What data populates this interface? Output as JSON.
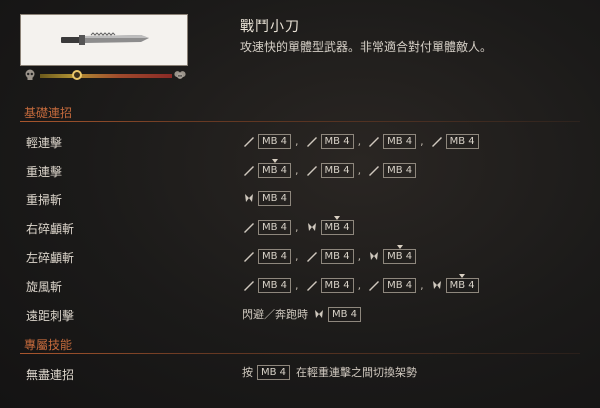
{
  "weapon": {
    "name": "戰鬥小刀",
    "description": "攻速快的單體型武器。非常適合對付單體敵人。",
    "image": "combat-knife",
    "stat_level": 0.28
  },
  "sections": {
    "basic": "基礎連招",
    "special": "專屬技能"
  },
  "mb_label": "MB 4",
  "moves": [
    {
      "name": "輕連擊"
    },
    {
      "name": "重連擊"
    },
    {
      "name": "重掃斬"
    },
    {
      "name": "右碎顱斬"
    },
    {
      "name": "左碎顱斬"
    },
    {
      "name": "旋風斬"
    },
    {
      "name": "遠距刺擊",
      "prefix": "閃避／奔跑時"
    }
  ],
  "special_moves": [
    {
      "name": "無盡連招",
      "prefix": "按",
      "suffix": "在輕重連擊之間切換架勢"
    }
  ],
  "colors": {
    "accent": "#c46a3c",
    "stat_marker": "#e9c76a"
  }
}
